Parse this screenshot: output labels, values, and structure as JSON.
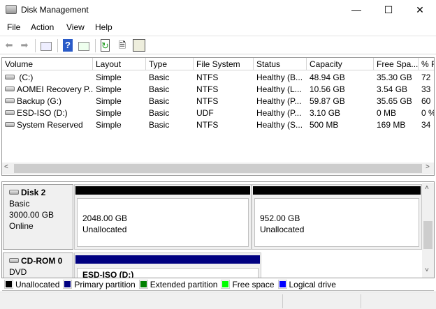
{
  "window": {
    "title": "Disk Management",
    "minimize": "—",
    "maximize": "☐",
    "close": "✕"
  },
  "menu": [
    "File",
    "Action",
    "View",
    "Help"
  ],
  "toolbar": [
    "back-icon",
    "forward-icon",
    "show-hide-console-tree-icon",
    "help-icon",
    "show-hide-action-pane-icon",
    "refresh-icon",
    "properties-icon",
    "settings-icon"
  ],
  "list": {
    "columns": [
      "Volume",
      "Layout",
      "Type",
      "File System",
      "Status",
      "Capacity",
      "Free Spa...",
      "% F"
    ],
    "rows": [
      {
        "icon": "drive-icon",
        "cells": [
          " (C:)",
          "Simple",
          "Basic",
          "NTFS",
          "Healthy (B...",
          "48.94 GB",
          "35.30 GB",
          "72"
        ]
      },
      {
        "icon": "drive-icon",
        "cells": [
          "AOMEI Recovery P...",
          "Simple",
          "Basic",
          "NTFS",
          "Healthy (L...",
          "10.56 GB",
          "3.54 GB",
          "33"
        ]
      },
      {
        "icon": "drive-icon",
        "cells": [
          "Backup (G:)",
          "Simple",
          "Basic",
          "NTFS",
          "Healthy (P...",
          "59.87 GB",
          "35.65 GB",
          "60"
        ]
      },
      {
        "icon": "cd-drive-icon",
        "cells": [
          "ESD-ISO (D:)",
          "Simple",
          "Basic",
          "UDF",
          "Healthy (P...",
          "3.10 GB",
          "0 MB",
          "0 %"
        ]
      },
      {
        "icon": "drive-icon",
        "cells": [
          "System Reserved",
          "Simple",
          "Basic",
          "NTFS",
          "Healthy (S...",
          "500 MB",
          "169 MB",
          "34"
        ]
      }
    ]
  },
  "disks": [
    {
      "name": "Disk 2",
      "type": "Basic",
      "size": "3000.00 GB",
      "state": "Online",
      "partitions": [
        {
          "size": "2048.00 GB",
          "label": "Unallocated",
          "color": "#000000"
        },
        {
          "size": "952.00 GB",
          "label": "Unallocated",
          "color": "#000000"
        }
      ]
    },
    {
      "name": "CD-ROM 0",
      "type": "DVD",
      "partitions": [
        {
          "label": "ESD-ISO  (D:)",
          "color": "#000080"
        }
      ]
    }
  ],
  "legend": [
    {
      "label": "Unallocated",
      "color": "#000000"
    },
    {
      "label": "Primary partition",
      "color": "#000080"
    },
    {
      "label": "Extended partition",
      "color": "#008000"
    },
    {
      "label": "Free space",
      "color": "#00ff00"
    },
    {
      "label": "Logical drive",
      "color": "#0000ff"
    }
  ]
}
